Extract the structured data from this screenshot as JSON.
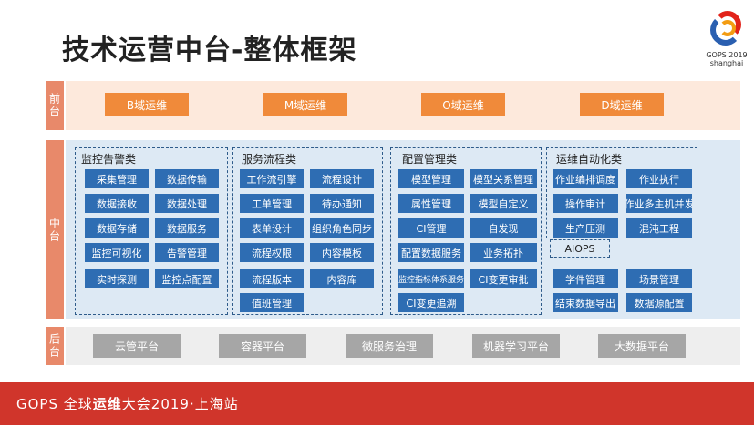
{
  "title": "技术运营中台-整体框架",
  "logo": {
    "line1": "GOPS 2019",
    "line2": "shanghai"
  },
  "layers": {
    "front": "前台",
    "middle": "中台",
    "back": "后台"
  },
  "front": [
    "B域运维",
    "M域运维",
    "O域运维",
    "D域运维"
  ],
  "back": [
    "云管平台",
    "容器平台",
    "微服务治理",
    "机器学习平台",
    "大数据平台"
  ],
  "groups": {
    "monitor": {
      "title": "监控告警类",
      "items": [
        "采集管理",
        "数据传输",
        "数据接收",
        "数据处理",
        "数据存储",
        "数据服务",
        "监控可视化",
        "告警管理",
        "实时探测",
        "监控点配置"
      ]
    },
    "service": {
      "title": "服务流程类",
      "items": [
        "工作流引擎",
        "流程设计",
        "工单管理",
        "待办通知",
        "表单设计",
        "组织角色同步",
        "流程权限",
        "内容模板",
        "流程版本",
        "内容库",
        "值班管理"
      ]
    },
    "config": {
      "title": "配置管理类",
      "items": [
        "模型管理",
        "模型关系管理",
        "属性管理",
        "模型自定义",
        "CI管理",
        "自发现",
        "配置数据服务",
        "业务拓扑",
        "监控指标体系服务",
        "CI变更审批",
        "CI变更追溯"
      ]
    },
    "auto": {
      "title": "运维自动化类",
      "items": [
        "作业编排调度",
        "作业执行",
        "操作审计",
        "作业多主机并发",
        "生产压测",
        "混沌工程"
      ],
      "aiops": "AIOPS",
      "extra": [
        "学件管理",
        "场景管理",
        "结束数据导出",
        "数据源配置"
      ]
    }
  },
  "footer": {
    "prefix": "GOPS 全球",
    "bold": "运维",
    "mid": "大会2019·上海站"
  }
}
